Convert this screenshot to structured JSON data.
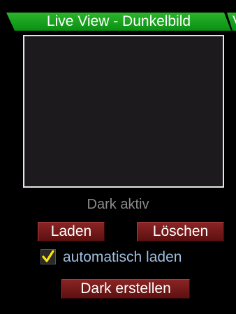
{
  "header": {
    "title": "Live View - Dunkelbild",
    "next_tab_label": "V"
  },
  "status": {
    "text": "Dark aktiv"
  },
  "buttons": {
    "load_label": "Laden",
    "delete_label": "Löschen",
    "create_dark_label": "Dark erstellen"
  },
  "auto_load": {
    "label": "automatisch laden",
    "checked": true
  },
  "colors": {
    "tab_green": "#12a01e",
    "button_red": "#7a1c1c",
    "check_yellow": "#ffe800",
    "label_blue": "#9fbfe0",
    "status_gray": "#8a8a8a",
    "preview_bg": "#1d1a1d"
  }
}
